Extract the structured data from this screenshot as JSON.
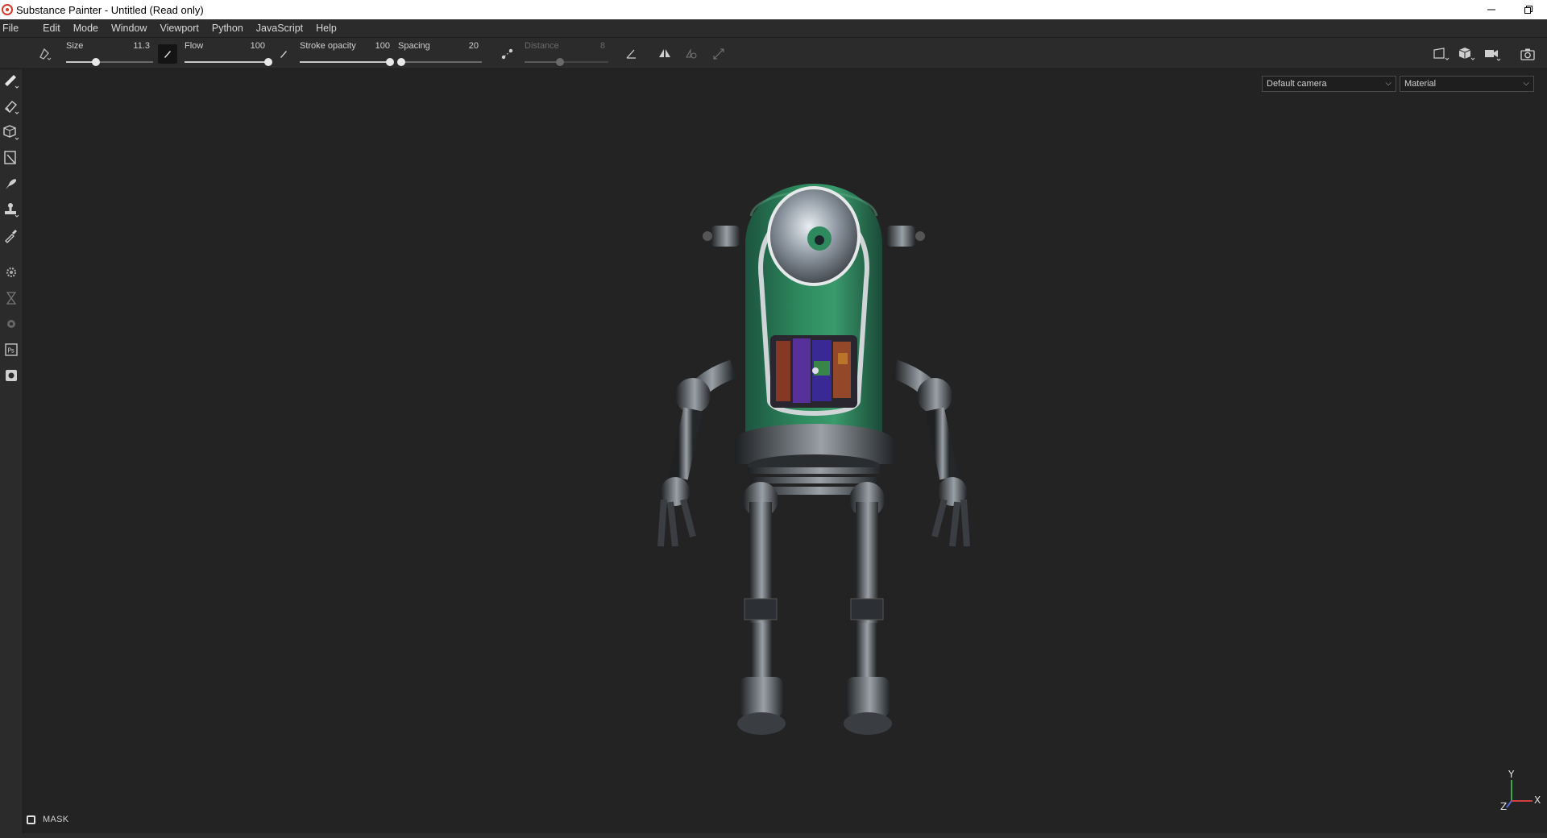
{
  "window": {
    "title": "Substance Painter - Untitled (Read only)",
    "minimize_icon": "minimize-icon",
    "restore_icon": "restore-icon"
  },
  "menu": [
    "File",
    "Edit",
    "Mode",
    "Window",
    "Viewport",
    "Python",
    "JavaScript",
    "Help"
  ],
  "toolbar": {
    "size": {
      "label": "Size",
      "value": "11.3",
      "fraction": 0.34
    },
    "flow": {
      "label": "Flow",
      "value": "100",
      "fraction": 1.0
    },
    "stroke_opacity": {
      "label": "Stroke opacity",
      "value": "100",
      "fraction": 1.0
    },
    "spacing": {
      "label": "Spacing",
      "value": "20",
      "fraction": 0.04
    },
    "distance": {
      "label": "Distance",
      "value": "8",
      "fraction": 0.42,
      "disabled": true
    }
  },
  "viewport": {
    "camera_select": "Default camera",
    "mode_select": "Material",
    "mask_label": "MASK",
    "axis_y": "Y",
    "axis_x": "X",
    "axis_z": "Z"
  },
  "colors": {
    "accent_green": "#2e8a5e",
    "titlebar_bg": "#ffffff",
    "panel_bg": "#2b2b2b",
    "viewport_bg": "#232323"
  }
}
